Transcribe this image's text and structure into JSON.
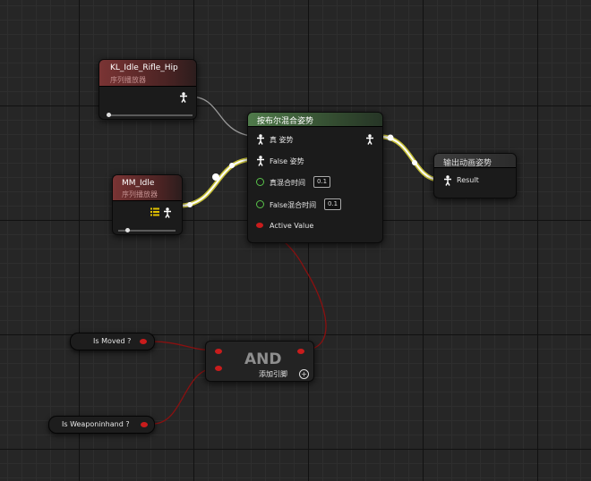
{
  "nodes": {
    "kl_idle": {
      "title": "KL_Idle_Rifle_Hip",
      "subtitle": "序列播放器",
      "play_position": 0.0
    },
    "mm_idle": {
      "title": "MM_Idle",
      "subtitle": "序列播放器",
      "play_position": 0.15
    },
    "blend": {
      "title": "按布尔混合姿势",
      "pins": {
        "true_pose": "真 姿势",
        "false_pose": "False 姿势",
        "true_blend_time": "真混合时间",
        "true_blend_value": "0.1",
        "false_blend_time": "False混合时间",
        "false_blend_value": "0.1",
        "active_value": "Active Value"
      }
    },
    "output": {
      "title": "输出动画姿势",
      "result": "Result"
    },
    "and": {
      "title": "AND",
      "add_pin": "添加引脚",
      "add_icon": "plus-circle-icon"
    },
    "is_moved": {
      "label": "Is Moved ?"
    },
    "is_weapon": {
      "label": "Is Weaponinhand ?"
    }
  },
  "colors": {
    "exec_wire": "#ffffff",
    "pose_wire_glow": "#d8d23a",
    "bool_wire": "#8a1010",
    "bool_pin": "#c91c1c",
    "float_pin": "#59c34a"
  }
}
